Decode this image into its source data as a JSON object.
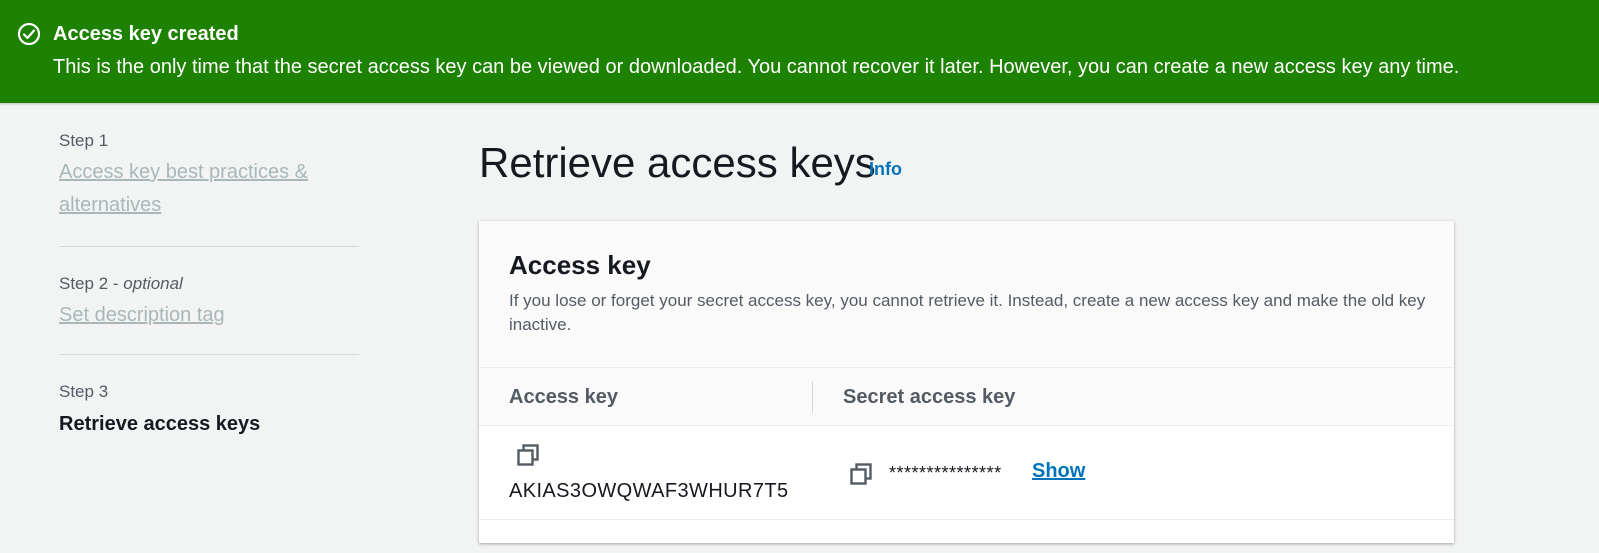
{
  "flash": {
    "icon": "check-circle-icon",
    "title": "Access key created",
    "message": "This is the only time that the secret access key can be viewed or downloaded. You cannot recover it later. However, you can create a new access key any time.",
    "color": "#1d8102"
  },
  "nav": {
    "steps": [
      {
        "label": "Step 1",
        "title": "Access key best practices & alternatives"
      },
      {
        "label": "Step 2 -",
        "optional": "optional",
        "title": "Set description tag"
      },
      {
        "label": "Step 3",
        "title": "Retrieve access keys"
      }
    ]
  },
  "page": {
    "title": "Retrieve access keys",
    "info": "Info"
  },
  "panel": {
    "title": "Access key",
    "description": "If you lose or forget your secret access key, you cannot retrieve it. Instead, create a new access key and make the old key inactive.",
    "columns": [
      "Access key",
      "Secret access key"
    ],
    "access_key": "AKIAS3OWQWAF3WHUR7T5",
    "secret_masked": "***************",
    "show_label": "Show",
    "copy_icon": "copy-icon"
  },
  "colors": {
    "link": "#0073bb",
    "disabled_link": "#aab7b8",
    "background": "#f2f3f3"
  }
}
